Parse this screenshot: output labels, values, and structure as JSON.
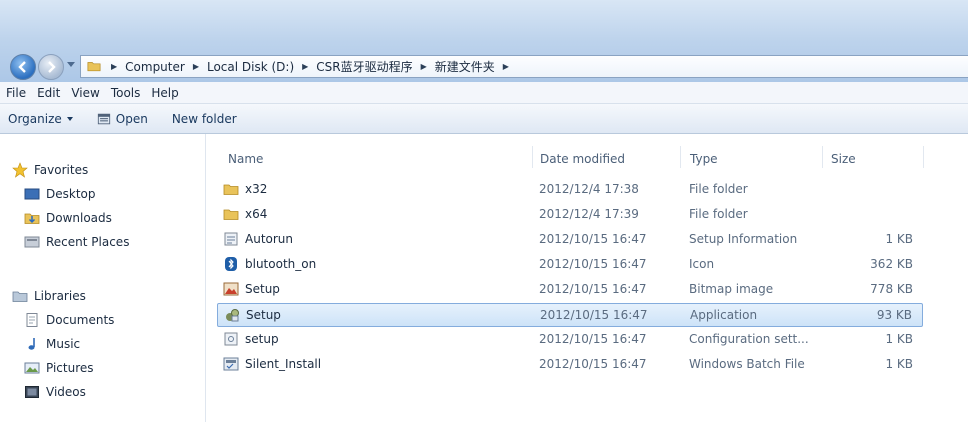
{
  "address": {
    "crumbs": [
      "Computer",
      "Local Disk (D:)",
      "CSR蓝牙驱动程序",
      "新建文件夹"
    ]
  },
  "menu": [
    "File",
    "Edit",
    "View",
    "Tools",
    "Help"
  ],
  "toolbar": {
    "organize": "Organize",
    "open": "Open",
    "new_folder": "New folder"
  },
  "nav": {
    "favorites": "Favorites",
    "desktop": "Desktop",
    "downloads": "Downloads",
    "recent": "Recent Places",
    "libraries": "Libraries",
    "documents": "Documents",
    "music": "Music",
    "pictures": "Pictures",
    "videos": "Videos"
  },
  "columns": {
    "name": "Name",
    "date": "Date modified",
    "type": "Type",
    "size": "Size"
  },
  "files": [
    {
      "name": "x32",
      "date": "2012/12/4 17:38",
      "type": "File folder",
      "size": "",
      "icon": "folder-icon"
    },
    {
      "name": "x64",
      "date": "2012/12/4 17:39",
      "type": "File folder",
      "size": "",
      "icon": "folder-icon"
    },
    {
      "name": "Autorun",
      "date": "2012/10/15 16:47",
      "type": "Setup Information",
      "size": "1 KB",
      "icon": "setup-info-icon"
    },
    {
      "name": "blutooth_on",
      "date": "2012/10/15 16:47",
      "type": "Icon",
      "size": "362 KB",
      "icon": "bluetooth-icon"
    },
    {
      "name": "Setup",
      "date": "2012/10/15 16:47",
      "type": "Bitmap image",
      "size": "778 KB",
      "icon": "bitmap-icon"
    },
    {
      "name": "Setup",
      "date": "2012/10/15 16:47",
      "type": "Application",
      "size": "93 KB",
      "icon": "application-icon",
      "selected": true
    },
    {
      "name": "setup",
      "date": "2012/10/15 16:47",
      "type": "Configuration sett...",
      "size": "1 KB",
      "icon": "config-icon"
    },
    {
      "name": "Silent_Install",
      "date": "2012/10/15 16:47",
      "type": "Windows Batch File",
      "size": "1 KB",
      "icon": "batch-file-icon"
    }
  ]
}
